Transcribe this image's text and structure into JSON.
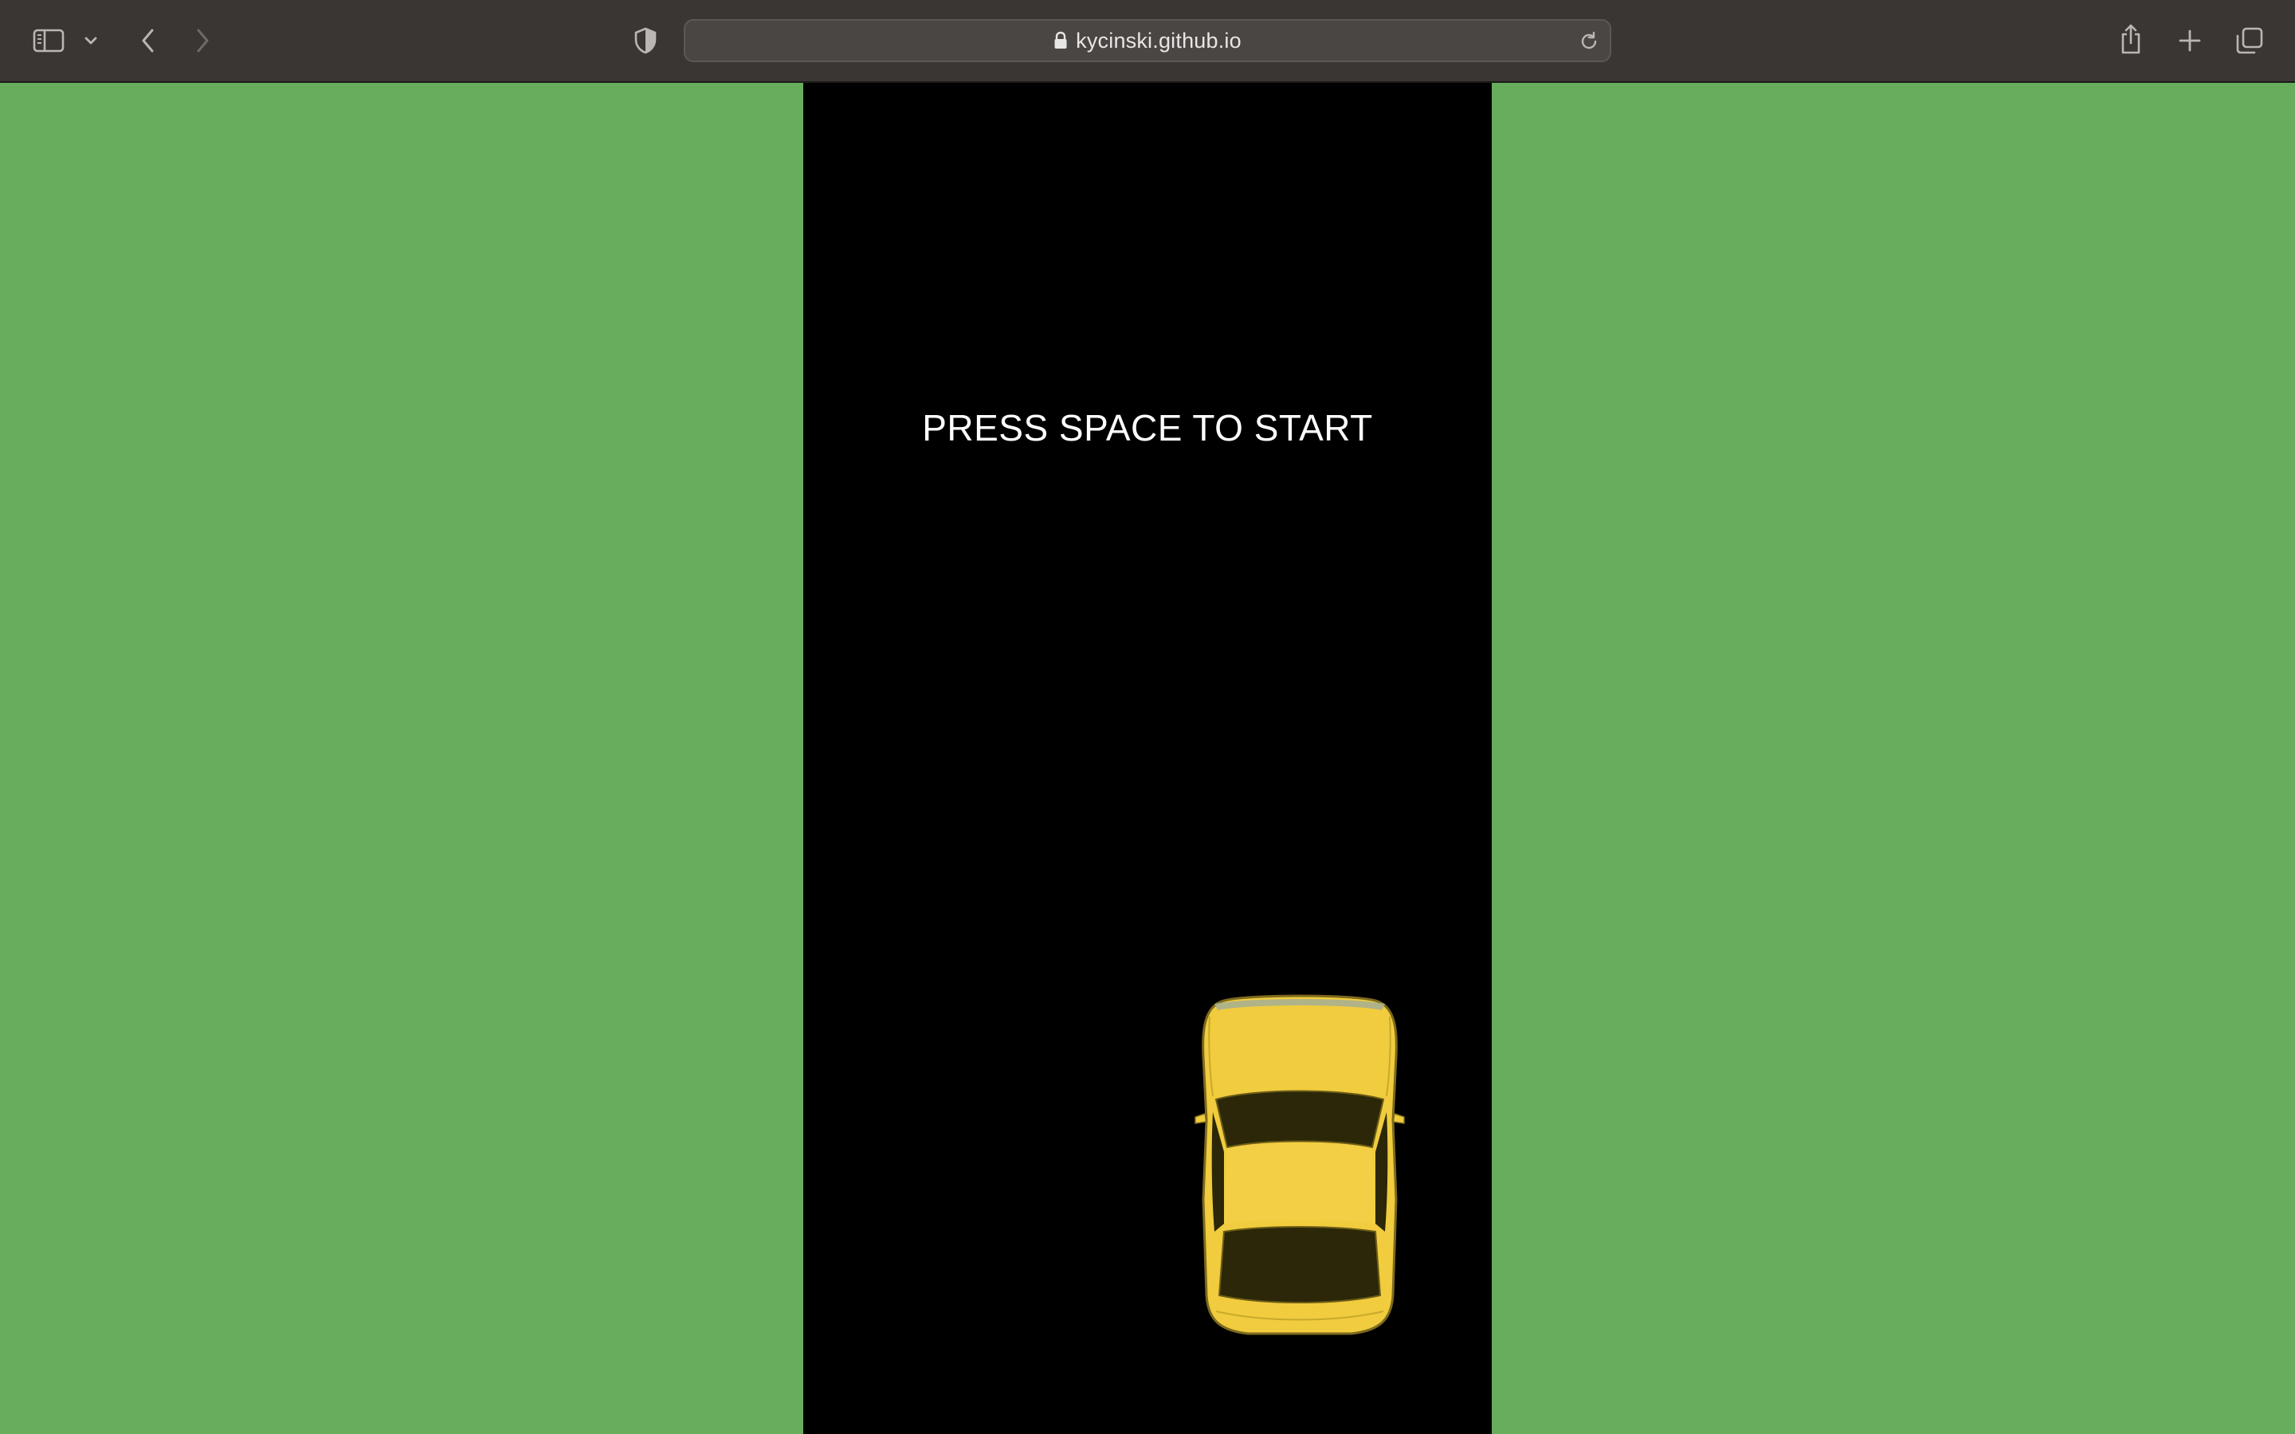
{
  "browser": {
    "url": "kycinski.github.io",
    "icons": {
      "sidebar": "sidebar-toggle-icon",
      "sidebar_menu": "chevron-down-icon",
      "back": "chevron-left-icon",
      "forward": "chevron-right-icon",
      "privacy": "shield-icon",
      "secure": "lock-icon",
      "reload": "reload-icon",
      "share": "share-icon",
      "new_tab": "plus-icon",
      "tabs": "tab-overview-icon"
    }
  },
  "game": {
    "start_message": "PRESS SPACE TO START",
    "colors": {
      "grass": "#68ad5d",
      "road": "#000000",
      "car": "#f0cc3e"
    },
    "player_car": "yellow-car"
  }
}
